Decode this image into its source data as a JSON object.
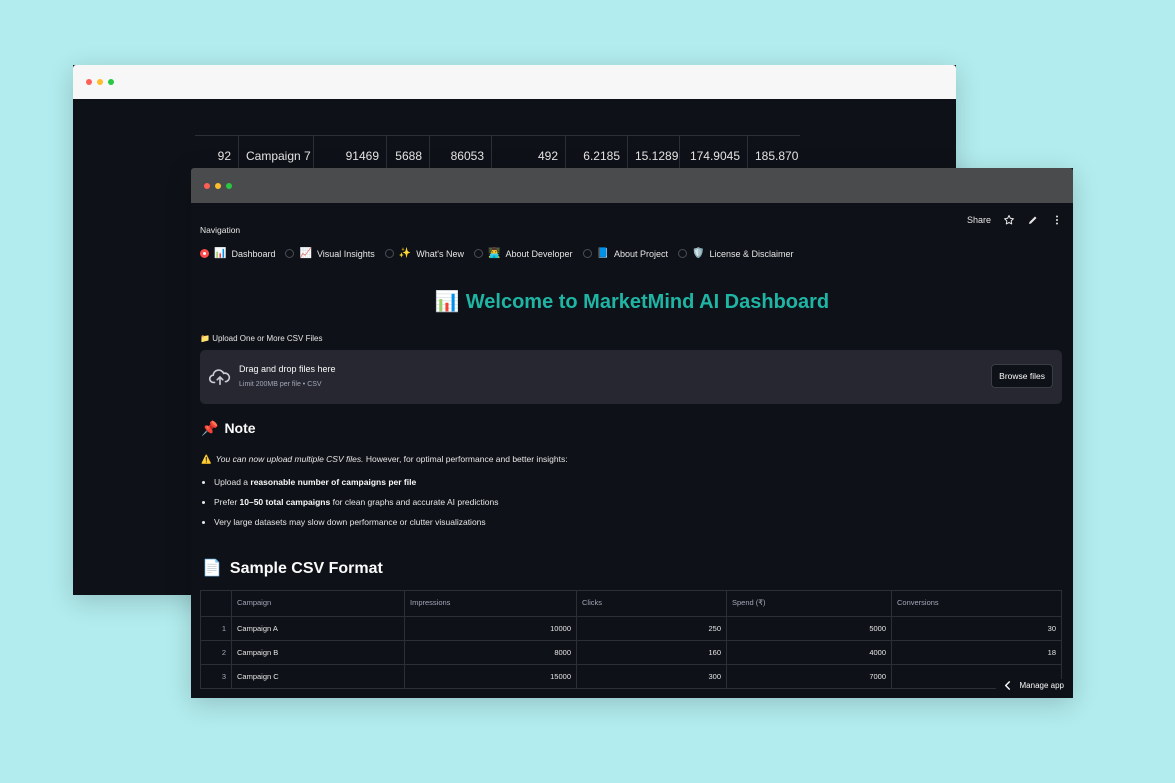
{
  "back_window": {
    "row": [
      "92",
      "Campaign 7",
      "91469",
      "5688",
      "86053",
      "492",
      "6.2185",
      "15.1289",
      "174.9045",
      "185.870"
    ]
  },
  "front_window": {
    "topbar": {
      "share_label": "Share",
      "star_icon": "star-icon",
      "edit_icon": "pencil-icon",
      "menu_icon": "kebab-menu-icon"
    },
    "navigation": {
      "label": "Navigation",
      "options": [
        {
          "emoji": "📊",
          "label": "Dashboard",
          "selected": true
        },
        {
          "emoji": "📈",
          "label": "Visual Insights",
          "selected": false
        },
        {
          "emoji": "✨",
          "label": "What's New",
          "selected": false
        },
        {
          "emoji": "👨‍💻",
          "label": "About Developer",
          "selected": false
        },
        {
          "emoji": "📘",
          "label": "About Project",
          "selected": false
        },
        {
          "emoji": "🛡️",
          "label": "License & Disclaimer",
          "selected": false
        }
      ]
    },
    "hero": {
      "icon": "📊",
      "title": "Welcome to MarketMind AI Dashboard"
    },
    "upload": {
      "label_icon": "📁",
      "label": "Upload One or More CSV Files",
      "drop_title": "Drag and drop files here",
      "drop_subtitle": "Limit 200MB per file • CSV",
      "browse_label": "Browse files"
    },
    "note": {
      "icon": "📌",
      "heading": "Note",
      "warning_icon": "⚠️",
      "warning_text": "You can now upload multiple CSV files.",
      "warning_rest": "However, for optimal performance and better insights:",
      "bullets": [
        {
          "pre": "Upload a ",
          "bold": "reasonable number of campaigns per file",
          "post": ""
        },
        {
          "pre": "Prefer ",
          "bold": "10–50 total campaigns",
          "post": " for clean graphs and accurate AI predictions"
        },
        {
          "pre": "Very large datasets may slow down performance or clutter visualizations",
          "bold": "",
          "post": ""
        }
      ]
    },
    "sample": {
      "icon": "📄",
      "heading": "Sample CSV Format",
      "columns": [
        "Campaign",
        "Impressions",
        "Clicks",
        "Spend (₹)",
        "Conversions"
      ],
      "rows": [
        [
          "1",
          "Campaign A",
          "10000",
          "250",
          "5000",
          "30"
        ],
        [
          "2",
          "Campaign B",
          "8000",
          "160",
          "4000",
          "18"
        ],
        [
          "3",
          "Campaign C",
          "15000",
          "300",
          "7000",
          ""
        ]
      ]
    },
    "manage_app": "Manage app"
  }
}
